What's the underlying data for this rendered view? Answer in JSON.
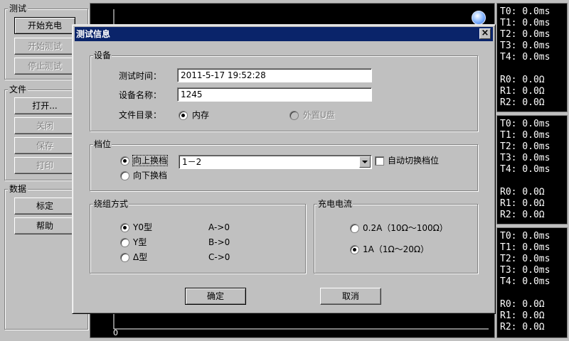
{
  "left_panel": {
    "test_group": {
      "title": "测试",
      "buttons": [
        "开始充电",
        "开始测试",
        "停止测试"
      ]
    },
    "file_group": {
      "title": "文件",
      "buttons": [
        "打开...",
        "关闭",
        "保存",
        "打印"
      ]
    },
    "data_group": {
      "title": "数据",
      "buttons": [
        "标定",
        "帮助"
      ]
    }
  },
  "graph": {
    "axis_zero": "0"
  },
  "readouts": [
    {
      "t": [
        "T0: 0.0ms",
        "T1: 0.0ms",
        "T2: 0.0ms",
        "T3: 0.0ms",
        "T4: 0.0ms"
      ],
      "r": [
        "R0: 0.0Ω",
        "R1: 0.0Ω",
        "R2: 0.0Ω"
      ]
    },
    {
      "t": [
        "T0: 0.0ms",
        "T1: 0.0ms",
        "T2: 0.0ms",
        "T3: 0.0ms",
        "T4: 0.0ms"
      ],
      "r": [
        "R0: 0.0Ω",
        "R1: 0.0Ω",
        "R2: 0.0Ω"
      ]
    },
    {
      "t": [
        "T0: 0.0ms",
        "T1: 0.0ms",
        "T2: 0.0ms",
        "T3: 0.0ms",
        "T4: 0.0ms"
      ],
      "r": [
        "R0: 0.0Ω",
        "R1: 0.0Ω",
        "R2: 0.0Ω"
      ]
    }
  ],
  "dialog": {
    "title": "测试信息",
    "close": "×",
    "device": {
      "title": "设备",
      "test_time_label": "测试时间：",
      "test_time_value": "2011-5-17 19:52:28",
      "device_name_label": "设备名称：",
      "device_name_value": "1245",
      "file_dir_label": "文件目录：",
      "memory_label": "内存",
      "usb_label": "外置U盘"
    },
    "tap": {
      "title": "档位",
      "up_label": "向上换档",
      "down_label": "向下换档",
      "range_value": "1－2",
      "auto_label": "自动切换档位"
    },
    "winding": {
      "title": "绕组方式",
      "options": [
        {
          "label": "Y0型",
          "map": "A->0"
        },
        {
          "label": "Y型",
          "map": "B->0"
        },
        {
          "label": "Δ型",
          "map": "C->0"
        }
      ]
    },
    "current": {
      "title": "充电电流",
      "opt1": "0.2A（10Ω～100Ω）",
      "opt2": "1A（1Ω～20Ω）"
    },
    "ok": "确定",
    "cancel": "取消"
  }
}
